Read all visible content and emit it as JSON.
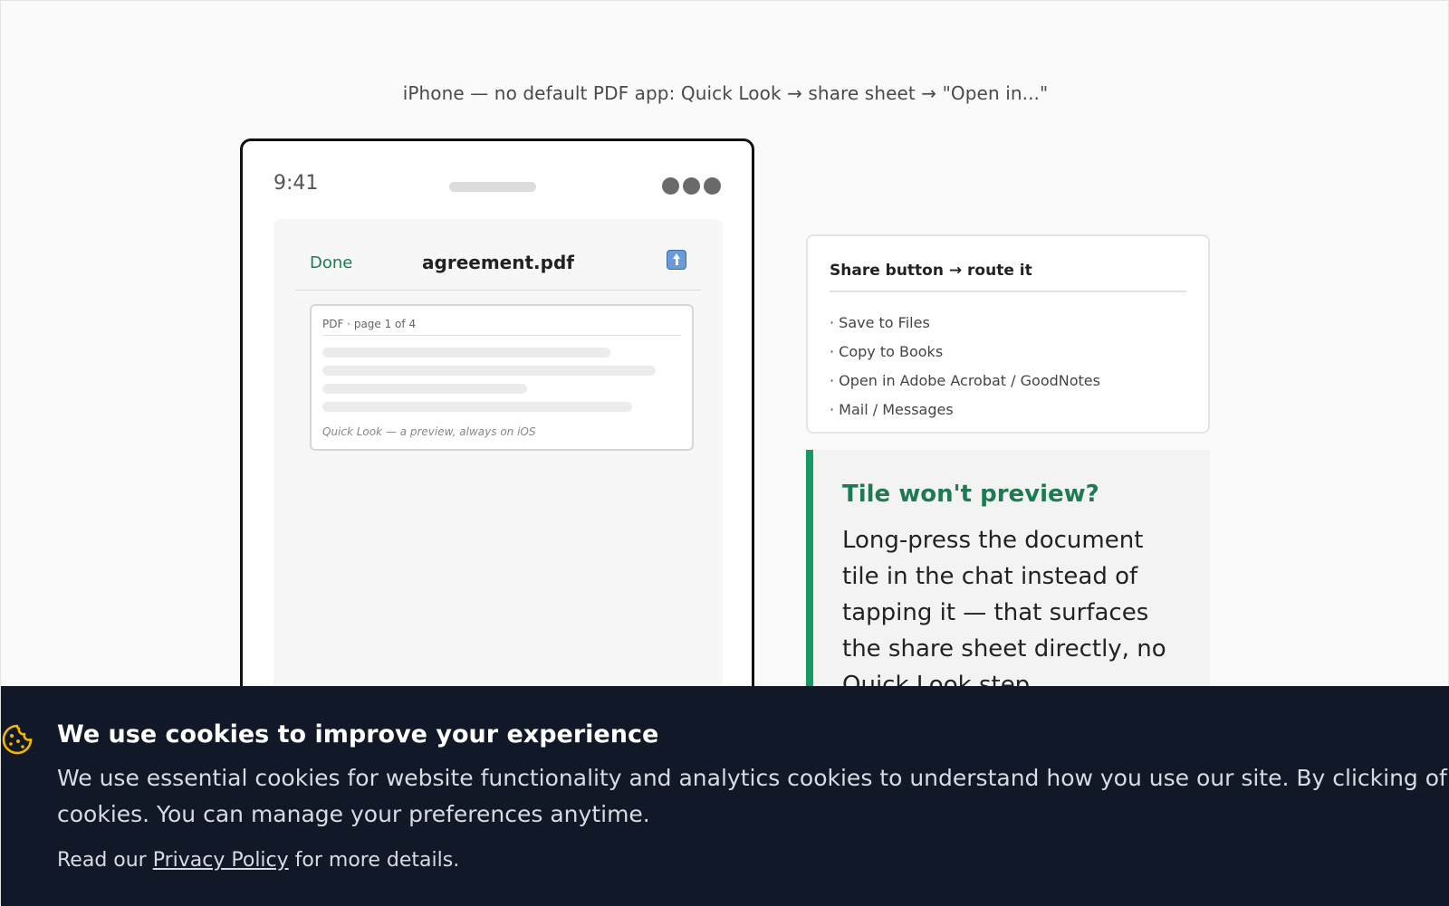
{
  "caption": "iPhone — no default PDF app: Quick Look → share sheet → \"Open in...\"",
  "phone": {
    "time": "9:41",
    "quicklook": {
      "done_label": "Done",
      "filename": "agreement.pdf",
      "share_icon": "share-icon",
      "pdf_header": "PDF · page 1 of 4",
      "pdf_footer": "Quick Look — a preview, always on iOS"
    }
  },
  "route_card": {
    "title": "Share button → route it",
    "items": [
      "· Save to Files",
      "· Copy to Books",
      "· Open in Adobe Acrobat / GoodNotes",
      "· Mail / Messages"
    ]
  },
  "callout": {
    "title": "Tile won't preview?",
    "body": "Long-press the document tile in the chat instead of tapping it — that surfaces the share sheet directly, no Quick Look step."
  },
  "cookie_banner": {
    "icon": "cookie-icon",
    "title": "We use cookies to improve your experience",
    "text": "We use essential cookies for website functionality and analytics cookies to understand how you use our site. By clicking of cookies. You can manage your preferences anytime.",
    "read_prefix": "Read our",
    "link_label": "Privacy Policy",
    "read_suffix": "for more details."
  },
  "colors": {
    "accent_green": "#1d7a52",
    "callout_border": "#159a63",
    "banner_bg": "#111827",
    "cookie_icon": "#f5b400"
  }
}
